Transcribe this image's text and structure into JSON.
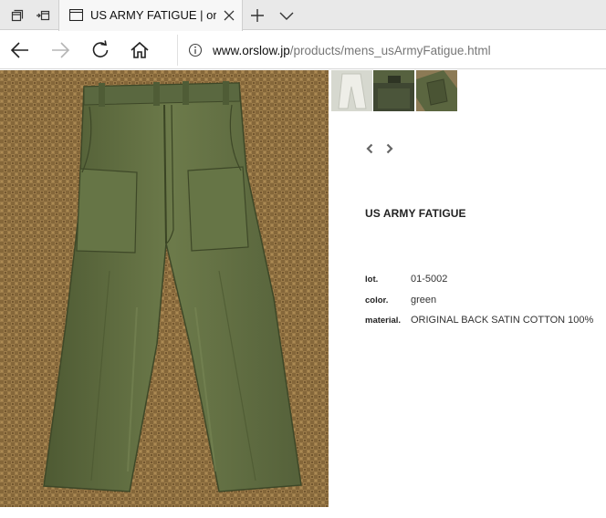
{
  "browser": {
    "tab": {
      "title": "US ARMY FATIGUE | orS"
    },
    "address": {
      "host": "www.orslow.jp",
      "path": "/products/mens_usArmyFatigue.html"
    }
  },
  "product": {
    "title": "US ARMY FATIGUE",
    "thumbnails": [
      {
        "icon": "thumbnail-light-pants"
      },
      {
        "icon": "thumbnail-green-pants-label"
      },
      {
        "icon": "thumbnail-green-pants-detail"
      }
    ],
    "specs": [
      {
        "label": "lot.",
        "value": "01-5002"
      },
      {
        "label": "color.",
        "value": "green"
      },
      {
        "label": "material.",
        "value": "ORIGINAL BACK SATIN COTTON 100%"
      }
    ]
  },
  "colors": {
    "pants_green": "#5d6b3f",
    "rug_tan": "#9b7a46",
    "tab_strip": "#e9e9e9"
  }
}
